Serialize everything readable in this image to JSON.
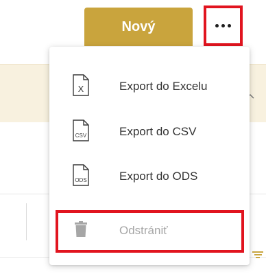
{
  "toolbar": {
    "new_label": "Nový",
    "more_icon": "more-horizontal-icon"
  },
  "menu": {
    "items": [
      {
        "label": "Export do Excelu",
        "icon": "excel-file-icon",
        "icon_text": "X",
        "enabled": true
      },
      {
        "label": "Export do CSV",
        "icon": "csv-file-icon",
        "icon_text": "CSV",
        "enabled": true
      },
      {
        "label": "Export do ODS",
        "icon": "ods-file-icon",
        "icon_text": "ODS",
        "enabled": true
      },
      {
        "label": "Odstrániť",
        "icon": "trash-icon",
        "enabled": false
      }
    ]
  },
  "colors": {
    "accent": "#c9a43d",
    "highlight": "#e1141f",
    "band": "#f8f1df",
    "disabled_text": "#a6a6a6"
  }
}
